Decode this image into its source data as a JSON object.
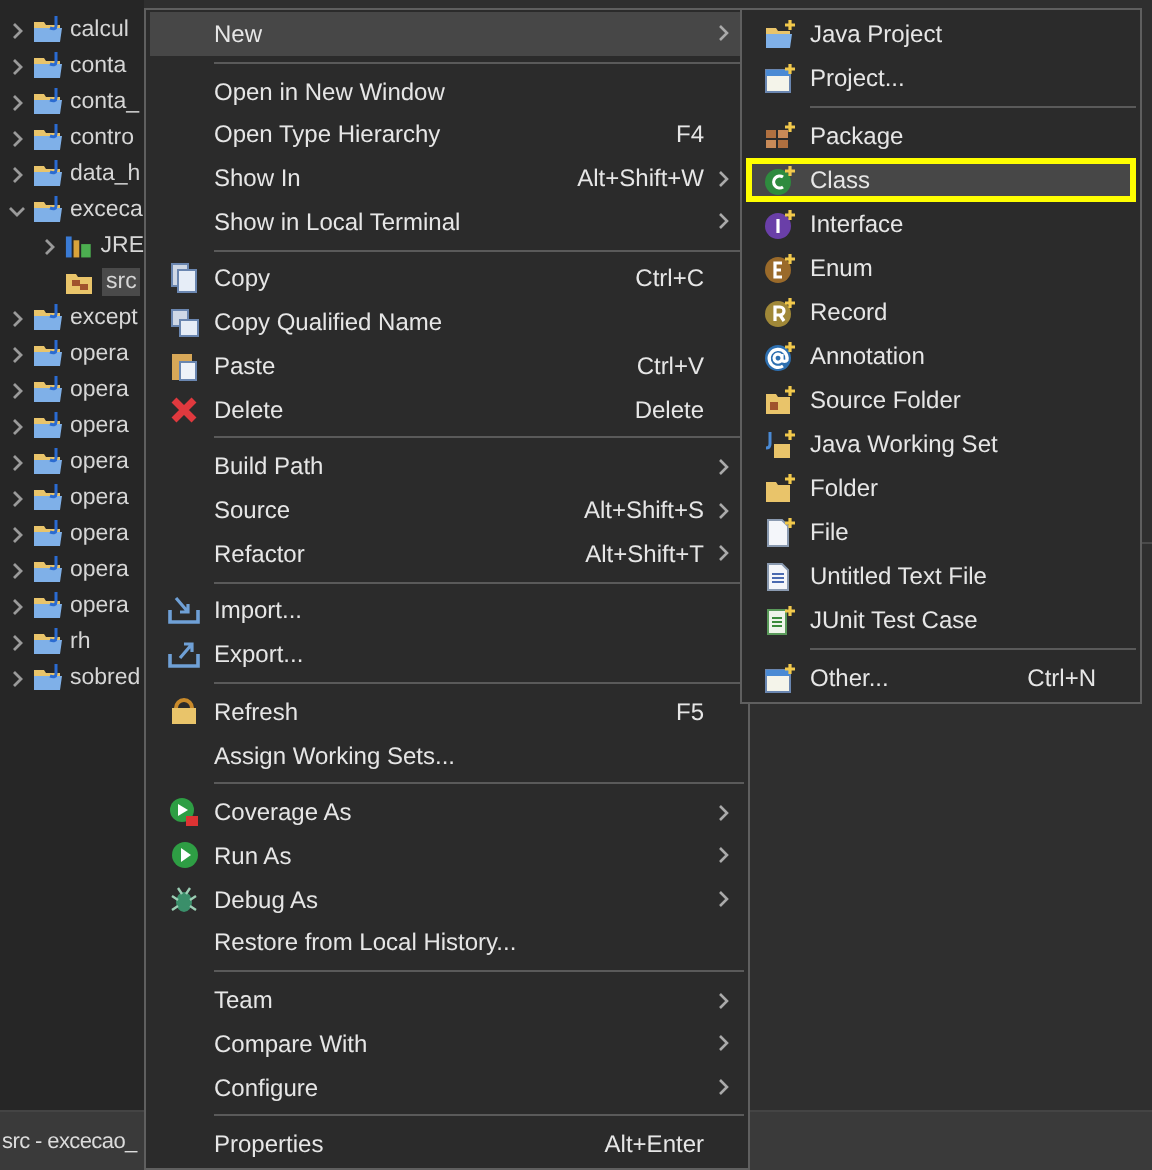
{
  "tree": {
    "items": [
      {
        "label": "calcul",
        "kind": "project",
        "expanded": false,
        "selected": false
      },
      {
        "label": "conta",
        "kind": "project",
        "expanded": false,
        "selected": false
      },
      {
        "label": "conta_",
        "kind": "project",
        "expanded": false,
        "selected": false
      },
      {
        "label": "contro",
        "kind": "project",
        "expanded": false,
        "selected": false
      },
      {
        "label": "data_h",
        "kind": "project",
        "expanded": false,
        "selected": false
      },
      {
        "label": "exceca",
        "kind": "project",
        "expanded": true,
        "selected": false,
        "children": [
          {
            "label": "JRE",
            "kind": "library",
            "expanded": false,
            "selected": false
          },
          {
            "label": "src",
            "kind": "source_folder",
            "selected": true
          }
        ]
      },
      {
        "label": "except",
        "kind": "project",
        "expanded": false,
        "selected": false
      },
      {
        "label": "opera",
        "kind": "project",
        "expanded": false,
        "selected": false
      },
      {
        "label": "opera",
        "kind": "project",
        "expanded": false,
        "selected": false
      },
      {
        "label": "opera",
        "kind": "project",
        "expanded": false,
        "selected": false
      },
      {
        "label": "opera",
        "kind": "project",
        "expanded": false,
        "selected": false
      },
      {
        "label": "opera",
        "kind": "project",
        "expanded": false,
        "selected": false
      },
      {
        "label": "opera",
        "kind": "project",
        "expanded": false,
        "selected": false
      },
      {
        "label": "opera",
        "kind": "project",
        "expanded": false,
        "selected": false
      },
      {
        "label": "opera",
        "kind": "project",
        "expanded": false,
        "selected": false
      },
      {
        "label": "rh",
        "kind": "project",
        "expanded": false,
        "selected": false
      },
      {
        "label": "sobred",
        "kind": "project",
        "expanded": false,
        "selected": false
      }
    ]
  },
  "status_bar": {
    "text": "src - excecao_"
  },
  "context_menu": {
    "items": [
      {
        "kind": "item",
        "label": "New",
        "submenu": true,
        "selected": true
      },
      {
        "kind": "separator"
      },
      {
        "kind": "item",
        "label": "Open in New Window",
        "submenu": false,
        "selected": false
      },
      {
        "kind": "item",
        "label": "Open Type Hierarchy",
        "shortcut": "F4",
        "submenu": false,
        "selected": false
      },
      {
        "kind": "item",
        "label": "Show In",
        "shortcut": "Alt+Shift+W",
        "submenu": true,
        "selected": false
      },
      {
        "kind": "item",
        "label": "Show in Local Terminal",
        "submenu": true,
        "selected": false
      },
      {
        "kind": "separator"
      },
      {
        "kind": "item",
        "label": "Copy",
        "shortcut": "Ctrl+C",
        "submenu": false,
        "selected": false
      },
      {
        "kind": "item",
        "label": "Copy Qualified Name",
        "submenu": false,
        "selected": false
      },
      {
        "kind": "item",
        "label": "Paste",
        "shortcut": "Ctrl+V",
        "submenu": false,
        "selected": false
      },
      {
        "kind": "item",
        "label": "Delete",
        "shortcut": "Delete",
        "submenu": false,
        "selected": false
      },
      {
        "kind": "separator"
      },
      {
        "kind": "item",
        "label": "Build Path",
        "submenu": true,
        "selected": false
      },
      {
        "kind": "item",
        "label": "Source",
        "shortcut": "Alt+Shift+S",
        "submenu": true,
        "selected": false
      },
      {
        "kind": "item",
        "label": "Refactor",
        "shortcut": "Alt+Shift+T",
        "submenu": true,
        "selected": false
      },
      {
        "kind": "separator"
      },
      {
        "kind": "item",
        "label": "Import...",
        "submenu": false,
        "selected": false
      },
      {
        "kind": "item",
        "label": "Export...",
        "submenu": false,
        "selected": false
      },
      {
        "kind": "separator"
      },
      {
        "kind": "item",
        "label": "Refresh",
        "shortcut": "F5",
        "submenu": false,
        "selected": false
      },
      {
        "kind": "item",
        "label": "Assign Working Sets...",
        "submenu": false,
        "selected": false
      },
      {
        "kind": "separator"
      },
      {
        "kind": "item",
        "label": "Coverage As",
        "submenu": true,
        "selected": false
      },
      {
        "kind": "item",
        "label": "Run As",
        "submenu": true,
        "selected": false
      },
      {
        "kind": "item",
        "label": "Debug As",
        "submenu": true,
        "selected": false
      },
      {
        "kind": "item",
        "label": "Restore from Local History...",
        "submenu": false,
        "selected": false
      },
      {
        "kind": "separator"
      },
      {
        "kind": "item",
        "label": "Team",
        "submenu": true,
        "selected": false
      },
      {
        "kind": "item",
        "label": "Compare With",
        "submenu": true,
        "selected": false
      },
      {
        "kind": "item",
        "label": "Configure",
        "submenu": true,
        "selected": false
      },
      {
        "kind": "separator"
      },
      {
        "kind": "item",
        "label": "Properties",
        "shortcut": "Alt+Enter",
        "submenu": false,
        "selected": false
      }
    ]
  },
  "new_submenu": {
    "items": [
      {
        "kind": "item",
        "label": "Java Project",
        "selected": false
      },
      {
        "kind": "item",
        "label": "Project...",
        "selected": false
      },
      {
        "kind": "separator"
      },
      {
        "kind": "item",
        "label": "Package",
        "selected": false
      },
      {
        "kind": "item",
        "label": "Class",
        "selected": true
      },
      {
        "kind": "item",
        "label": "Interface",
        "selected": false
      },
      {
        "kind": "item",
        "label": "Enum",
        "selected": false
      },
      {
        "kind": "item",
        "label": "Record",
        "selected": false
      },
      {
        "kind": "item",
        "label": "Annotation",
        "selected": false
      },
      {
        "kind": "item",
        "label": "Source Folder",
        "selected": false
      },
      {
        "kind": "item",
        "label": "Java Working Set",
        "selected": false
      },
      {
        "kind": "item",
        "label": "Folder",
        "selected": false
      },
      {
        "kind": "item",
        "label": "File",
        "selected": false
      },
      {
        "kind": "item",
        "label": "Untitled Text File",
        "selected": false
      },
      {
        "kind": "item",
        "label": "JUnit Test Case",
        "selected": false
      },
      {
        "kind": "separator"
      },
      {
        "kind": "item",
        "label": "Other...",
        "shortcut": "Ctrl+N",
        "selected": false
      }
    ]
  }
}
